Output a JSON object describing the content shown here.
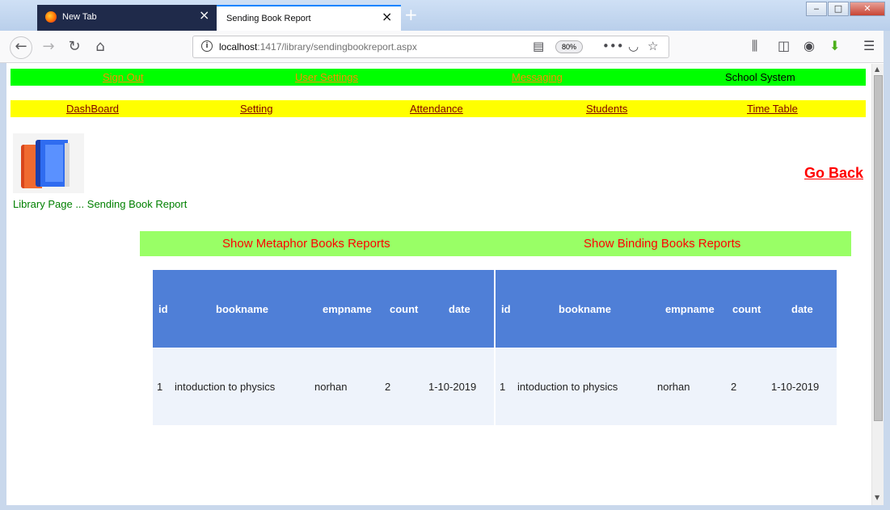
{
  "browser": {
    "tabs": [
      {
        "label": "New Tab"
      },
      {
        "label": "Sending Book Report"
      }
    ],
    "url_host": "localhost",
    "url_rest": ":1417/library/sendingbookreport.aspx",
    "zoom": "80%"
  },
  "top_nav": {
    "sign_out": "Sign Out",
    "user_settings": "User Settings",
    "messaging": "Messaging",
    "brand": "School System"
  },
  "main_nav": {
    "dashboard": "DashBoard",
    "setting": "Setting",
    "attendance": "Attendance",
    "students": "Students",
    "time_table": "Time Table"
  },
  "page": {
    "breadcrumb": "Library Page ... Sending Book Report",
    "go_back": "Go Back",
    "show_metaphor": "Show Metaphor Books Reports",
    "show_binding": "Show Binding Books Reports"
  },
  "tables": [
    {
      "headers": [
        "id",
        "bookname",
        "empname",
        "count",
        "date"
      ],
      "rows": [
        [
          "1",
          "intoduction to physics",
          "norhan",
          "2",
          "1-10-2019"
        ]
      ]
    },
    {
      "headers": [
        "id",
        "bookname",
        "empname",
        "count",
        "date"
      ],
      "rows": [
        [
          "1",
          "intoduction to physics",
          "norhan",
          "2",
          "1-10-2019"
        ]
      ]
    }
  ],
  "colors": {
    "top_nav_bg": "#00ff00",
    "main_nav_bg": "#ffff00",
    "report_bar_bg": "#99ff66",
    "table_header_bg": "#4f7fd7",
    "go_back": "#ff0000"
  }
}
